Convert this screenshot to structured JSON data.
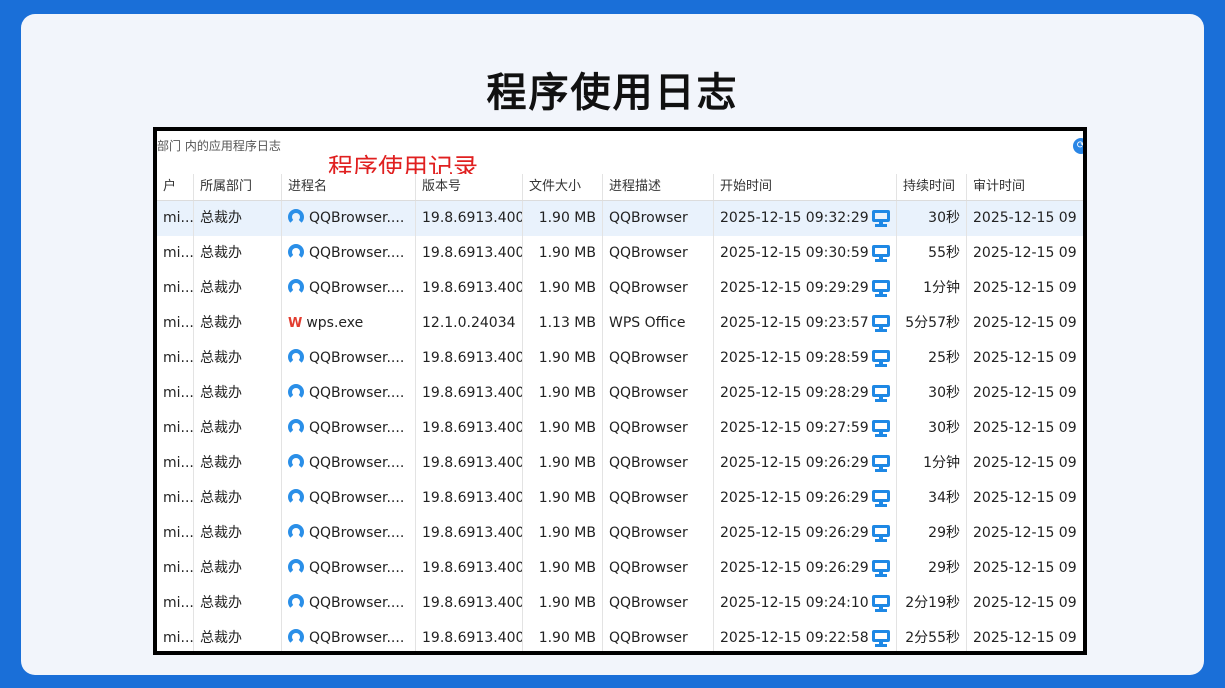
{
  "page": {
    "title": "程序使用日志"
  },
  "window": {
    "caption": "部门 内的应用程序日志",
    "annotation": "程序使用记录"
  },
  "table": {
    "columns": [
      "户",
      "所属部门",
      "进程名",
      "版本号",
      "文件大小",
      "进程描述",
      "开始时间",
      "持续时间",
      "审计时间"
    ],
    "rows": [
      {
        "user": "mi...",
        "dept": "总裁办",
        "icon": "qqbrowser-icon",
        "proc": "QQBrowser....",
        "ver": "19.8.6913.400",
        "size": "1.90 MB",
        "desc": "QQBrowser",
        "start": "2025-12-15 09:32:29",
        "dur": "30秒",
        "audit": "2025-12-15 09"
      },
      {
        "user": "mi...",
        "dept": "总裁办",
        "icon": "qqbrowser-icon",
        "proc": "QQBrowser....",
        "ver": "19.8.6913.400",
        "size": "1.90 MB",
        "desc": "QQBrowser",
        "start": "2025-12-15 09:30:59",
        "dur": "55秒",
        "audit": "2025-12-15 09"
      },
      {
        "user": "mi...",
        "dept": "总裁办",
        "icon": "qqbrowser-icon",
        "proc": "QQBrowser....",
        "ver": "19.8.6913.400",
        "size": "1.90 MB",
        "desc": "QQBrowser",
        "start": "2025-12-15 09:29:29",
        "dur": "1分钟",
        "audit": "2025-12-15 09"
      },
      {
        "user": "mi...",
        "dept": "总裁办",
        "icon": "wps-icon",
        "proc": "wps.exe",
        "ver": "12.1.0.24034",
        "size": "1.13 MB",
        "desc": "WPS Office",
        "start": "2025-12-15 09:23:57",
        "dur": "5分57秒",
        "audit": "2025-12-15 09"
      },
      {
        "user": "mi...",
        "dept": "总裁办",
        "icon": "qqbrowser-icon",
        "proc": "QQBrowser....",
        "ver": "19.8.6913.400",
        "size": "1.90 MB",
        "desc": "QQBrowser",
        "start": "2025-12-15 09:28:59",
        "dur": "25秒",
        "audit": "2025-12-15 09"
      },
      {
        "user": "mi...",
        "dept": "总裁办",
        "icon": "qqbrowser-icon",
        "proc": "QQBrowser....",
        "ver": "19.8.6913.400",
        "size": "1.90 MB",
        "desc": "QQBrowser",
        "start": "2025-12-15 09:28:29",
        "dur": "30秒",
        "audit": "2025-12-15 09"
      },
      {
        "user": "mi...",
        "dept": "总裁办",
        "icon": "qqbrowser-icon",
        "proc": "QQBrowser....",
        "ver": "19.8.6913.400",
        "size": "1.90 MB",
        "desc": "QQBrowser",
        "start": "2025-12-15 09:27:59",
        "dur": "30秒",
        "audit": "2025-12-15 09"
      },
      {
        "user": "mi...",
        "dept": "总裁办",
        "icon": "qqbrowser-icon",
        "proc": "QQBrowser....",
        "ver": "19.8.6913.400",
        "size": "1.90 MB",
        "desc": "QQBrowser",
        "start": "2025-12-15 09:26:29",
        "dur": "1分钟",
        "audit": "2025-12-15 09"
      },
      {
        "user": "mi...",
        "dept": "总裁办",
        "icon": "qqbrowser-icon",
        "proc": "QQBrowser....",
        "ver": "19.8.6913.400",
        "size": "1.90 MB",
        "desc": "QQBrowser",
        "start": "2025-12-15 09:26:29",
        "dur": "34秒",
        "audit": "2025-12-15 09"
      },
      {
        "user": "mi...",
        "dept": "总裁办",
        "icon": "qqbrowser-icon",
        "proc": "QQBrowser....",
        "ver": "19.8.6913.400",
        "size": "1.90 MB",
        "desc": "QQBrowser",
        "start": "2025-12-15 09:26:29",
        "dur": "29秒",
        "audit": "2025-12-15 09"
      },
      {
        "user": "mi...",
        "dept": "总裁办",
        "icon": "qqbrowser-icon",
        "proc": "QQBrowser....",
        "ver": "19.8.6913.400",
        "size": "1.90 MB",
        "desc": "QQBrowser",
        "start": "2025-12-15 09:26:29",
        "dur": "29秒",
        "audit": "2025-12-15 09"
      },
      {
        "user": "mi...",
        "dept": "总裁办",
        "icon": "qqbrowser-icon",
        "proc": "QQBrowser....",
        "ver": "19.8.6913.400",
        "size": "1.90 MB",
        "desc": "QQBrowser",
        "start": "2025-12-15 09:24:10",
        "dur": "2分19秒",
        "audit": "2025-12-15 09"
      },
      {
        "user": "mi...",
        "dept": "总裁办",
        "icon": "qqbrowser-icon",
        "proc": "QQBrowser....",
        "ver": "19.8.6913.400",
        "size": "1.90 MB",
        "desc": "QQBrowser",
        "start": "2025-12-15 09:22:58",
        "dur": "2分55秒",
        "audit": "2025-12-15 09"
      }
    ],
    "row_icon": "monitor-icon",
    "colors": {
      "selected_row": "#e9f2fc",
      "icon_blue": "#1e88e5",
      "wps_red": "#e23c2f",
      "annotation": "#e02020"
    }
  }
}
